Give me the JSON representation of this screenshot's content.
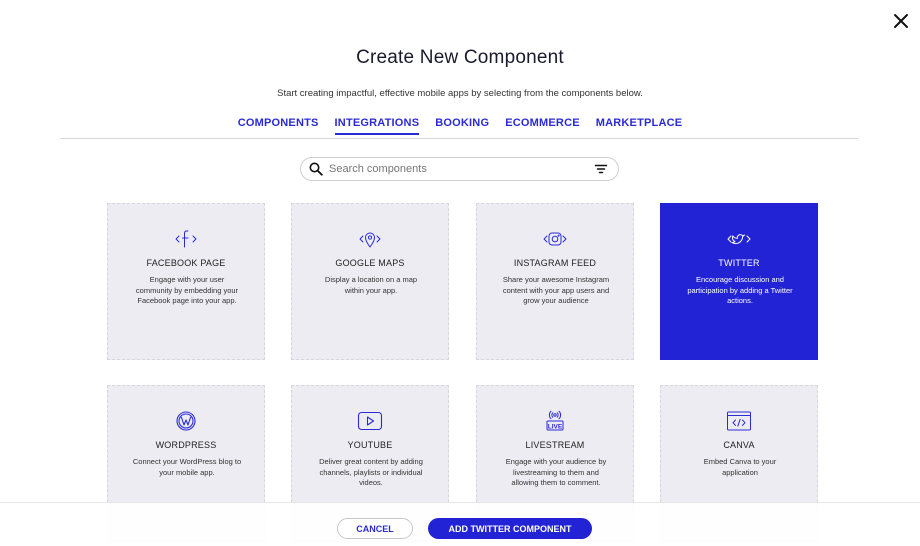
{
  "dialog": {
    "title": "Create New Component",
    "subtitle": "Start creating impactful, effective mobile apps by selecting from the components below."
  },
  "tabs": [
    {
      "label": "COMPONENTS",
      "active": false
    },
    {
      "label": "INTEGRATIONS",
      "active": true
    },
    {
      "label": "BOOKING",
      "active": false
    },
    {
      "label": "ECOMMERCE",
      "active": false
    },
    {
      "label": "MARKETPLACE",
      "active": false
    }
  ],
  "search": {
    "placeholder": "Search components",
    "value": ""
  },
  "cards": [
    {
      "name": "FACEBOOK PAGE",
      "icon": "facebook-icon",
      "description": "Engage with your user community by embedding your Facebook page into your app.",
      "selected": false
    },
    {
      "name": "GOOGLE MAPS",
      "icon": "map-pin-icon",
      "description": "Display a location on a map within your app.",
      "selected": false
    },
    {
      "name": "INSTAGRAM FEED",
      "icon": "instagram-icon",
      "description": "Share your awesome Instagram content with your app users and grow your audience",
      "selected": false
    },
    {
      "name": "TWITTER",
      "icon": "twitter-icon",
      "description": "Encourage discussion and participation by adding a Twitter actions.",
      "selected": true
    },
    {
      "name": "WORDPRESS",
      "icon": "wordpress-icon",
      "description": "Connect your WordPress blog to your mobile app.",
      "selected": false
    },
    {
      "name": "YOUTUBE",
      "icon": "youtube-icon",
      "description": "Deliver great content by adding channels, playlists or individual videos.",
      "selected": false
    },
    {
      "name": "LIVESTREAM",
      "icon": "livestream-icon",
      "description": "Engage with your audience by livestreaming to them and allowing them to comment.",
      "selected": false
    },
    {
      "name": "CANVA",
      "icon": "canva-icon",
      "description": "Embed Canva to your application",
      "selected": false
    }
  ],
  "footer": {
    "cancel_label": "CANCEL",
    "add_label": "ADD TWITTER COMPONENT"
  },
  "colors": {
    "accent": "#2323d6",
    "card_bg": "#ececf2"
  }
}
